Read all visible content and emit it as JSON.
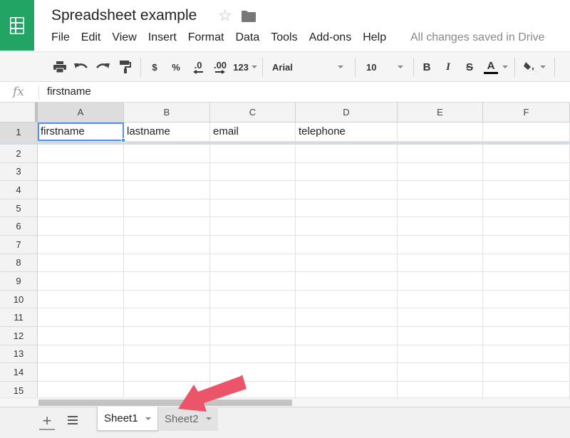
{
  "app": {
    "title": "Spreadsheet example",
    "saved_status": "All changes saved in Drive"
  },
  "menu": [
    "File",
    "Edit",
    "View",
    "Insert",
    "Format",
    "Data",
    "Tools",
    "Add-ons",
    "Help"
  ],
  "toolbar": {
    "currency_label": "$",
    "percent_label": "%",
    "decrease_decimals_label": ".0",
    "increase_decimals_label": ".00",
    "more_formats_label": "123",
    "font_family": "Arial",
    "font_size": "10",
    "bold_label": "B",
    "italic_label": "I",
    "strikethrough_label": "S",
    "text_color_label": "A"
  },
  "formula_bar": {
    "fx_label": "fx",
    "value": "firstname"
  },
  "grid": {
    "columns": [
      "A",
      "B",
      "C",
      "D",
      "E",
      "F"
    ],
    "rows": [
      "1",
      "2",
      "3",
      "4",
      "5",
      "6",
      "7",
      "8",
      "9",
      "10",
      "11",
      "12",
      "13",
      "14",
      "15"
    ],
    "cells": [
      [
        "firstname",
        "lastname",
        "email",
        "telephone",
        "",
        ""
      ]
    ],
    "selected_cell": "A1"
  },
  "sheets": [
    {
      "label": "Sheet1",
      "active": true
    },
    {
      "label": "Sheet2",
      "active": false
    }
  ],
  "colors": {
    "brand_green": "#21a464",
    "selection_blue": "#4d90fe",
    "annotation_arrow": "#ec5569"
  }
}
